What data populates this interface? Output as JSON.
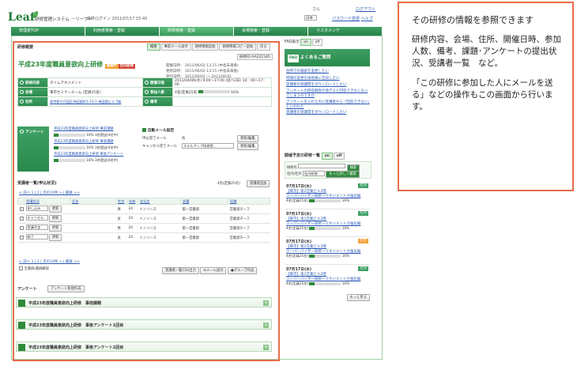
{
  "header": {
    "logo": "Leaf",
    "app_title": "研修管理システム －リーフ－",
    "date": "最終ログイン 2011/07/17 15:45",
    "user": "さん",
    "logout": "ログアウト",
    "lang": "日本",
    "pw_link": "パスワード変更",
    "help": "ヘルプ"
  },
  "tabs": [
    "管理者TOP",
    "利用者検索・登録",
    "研修検索・登録",
    "会場検索・登録",
    "マスタメンテ"
  ],
  "detail": {
    "section": "研修概要",
    "sub_tabs": [
      "概要",
      "事前メール送付",
      "研修情報追加",
      "研修情報コピー追加",
      "戻る"
    ],
    "code": "AA221545",
    "title": "平成23年度職員意欲向上研修",
    "badge_status": "開催中",
    "badge_type": "社内研修",
    "dates": [
      {
        "label": "開催日時：",
        "value": "2011/06/02 13:15 (中島未来香)"
      },
      {
        "label": "更新日時：",
        "value": "2011/06/02 13:15 (中島未来香)"
      },
      {
        "label": "受付日時：",
        "value": "2011/04/01 ～ 2011/06/01"
      }
    ],
    "org_label": "研修内容",
    "org_value": "タイムマネジメント",
    "date_label": "開催日程",
    "date_value": "2011/04/06(水) 9:00～17:00 (延べ2日) 10：00～17：00",
    "venue_label": "会場",
    "venue_value": "東京セミナールーム (定員25名)",
    "count_label": "参加人数",
    "count_value": "4名/定員25名",
    "count_pct": "16%",
    "address_label": "住所",
    "address_value": "東京都千代田区神田錦町1-10-1 神田錦ビル 5階",
    "note_label": "備考",
    "survey_label": "アンケート",
    "surveys": [
      {
        "name": "平成23年度職員意欲向上研修 事前課題",
        "pct": "16%",
        "count": "3名提出(4名中)"
      },
      {
        "name": "平成23年度職員意欲向上研修 事後課題",
        "pct": "16%",
        "count": "3名提出(4名中)"
      },
      {
        "name": "平成23年度職員意欲向上研修 事後アンケート",
        "pct": "16%",
        "count": "3名提出(4名中)"
      }
    ],
    "mail_label": "自動メール設定",
    "mail_rows": [
      {
        "label": "申込完了メール",
        "value": "有",
        "btn": "参照/編集"
      },
      {
        "label": "キャンセル完了メール",
        "value": "スキルアップ研修受...",
        "btn": "参照/編集"
      }
    ],
    "progress": [
      {
        "pct": 16
      },
      {
        "pct": 16
      },
      {
        "pct": 16
      },
      {
        "pct": 16
      }
    ]
  },
  "participants": {
    "section": "受講者一覧(申込状況)",
    "summary": "4名(定員25名)",
    "add_btn": "受講者追加",
    "pager": "< 前へ 1 | 2 | 次の10件 > | 最後 >>",
    "columns": [
      "受講状況",
      "氏名",
      "性別",
      "年齢",
      "会社名",
      "部署",
      "役職"
    ],
    "rows": [
      {
        "status": "申し込み",
        "name": "",
        "sex": "男",
        "age": "24",
        "company": "イノソース",
        "dept": "第一営業部",
        "post": "営業部チーフ"
      },
      {
        "status": "キャンセル",
        "name": "",
        "sex": "女",
        "age": "24",
        "company": "イノソース",
        "dept": "第一営業部",
        "post": "営業部チーフ"
      },
      {
        "status": "受講予定",
        "name": "",
        "sex": "男",
        "age": "24",
        "company": "イノソース",
        "dept": "第一営業部",
        "post": "営業部チーフ"
      },
      {
        "status": "修了",
        "name": "",
        "sex": "女",
        "age": "24",
        "company": "イノソース",
        "dept": "第一営業部",
        "post": "営業部チーフ"
      }
    ],
    "update_btn": "更新",
    "select_all": "全選択/選択解除",
    "csv_btn": "受講者一覧CSV出力",
    "mail_btn": "メール送付",
    "group_btn": "グループ作成"
  },
  "survey_section": {
    "label": "アンケート",
    "new_btn": "アンケート新規作成",
    "items": [
      "平成23年度職員意欲向上研修　事前課題",
      "平成23年度職員意欲向上研修　事後アンケート1回目",
      "平成23年度職員意欲向上研修　事後アンケート2回目"
    ]
  },
  "faq": {
    "label": "FAQ表示",
    "on": "on",
    "off": "off",
    "title": "よくあるご質問",
    "links": [
      "住所での検索を変更したい",
      "時間の変更を研修員に告知したい",
      "受講者の受講票をダウンロードしたい",
      "アンケートの回答期限が過ぎると回答できなくなってしまうのですか",
      "アンケートを入れたのに受講者から「回答できない」といわれた",
      "受講者の受講票をダウンロードしたい"
    ]
  },
  "upcoming": {
    "label": "開催予定の研修一覧",
    "on": "on",
    "off": "off",
    "f_name": "研修名",
    "search_btn": "検索",
    "f_type": "社内/社外",
    "f_type_value": "社内研修",
    "more_btn": "もっと詳しく検索",
    "items": [
      {
        "date": "07月17日(水)",
        "badge": "社内",
        "place": "【東京】第2営業ビル2階",
        "title": "スーパーバイザー研修～マネジメント力強化編",
        "count": "4名(定員25名)",
        "pct": "16%"
      },
      {
        "date": "07月17日(水)",
        "badge": "社内",
        "place": "【東京】第2営業ビル2階",
        "title": "スーパーバイザー研修～マネジメント力強化編",
        "count": "4名(定員25名)",
        "pct": "16%"
      },
      {
        "date": "07月17日(水)",
        "badge": "社外",
        "place": "【東京】第2営業ビル2階",
        "title": "スーパーバイザー研修～マネジメント力強化編",
        "count": "4名(定員25名)",
        "pct": "16%"
      },
      {
        "date": "07月17日(水)",
        "badge": "社内",
        "place": "【東京】第2営業ビル2階",
        "title": "スーパーバイザー研修～マネジメント力強化編",
        "count": "4名(定員25名)",
        "pct": "16%"
      }
    ],
    "more_link": "もっと見る"
  },
  "callout": {
    "heading": "その研修の情報を参照できます",
    "body": "研修内容、会場、住所、開催日時、参加人数、備考、課題･アンケートの提出状況、受講者一覧　など。",
    "body2": "「この研修に参加した人にメールを送る」などの操作もこの画面から行います。"
  }
}
